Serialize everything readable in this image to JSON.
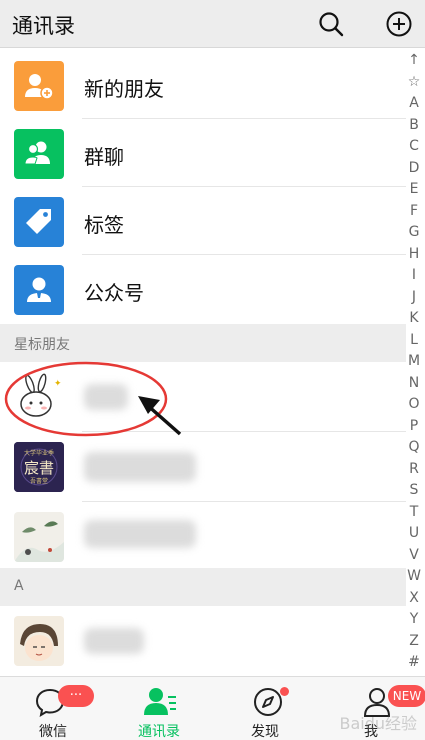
{
  "header": {
    "title": "通讯录",
    "search_icon": "search-icon",
    "add_icon": "plus-circle-icon"
  },
  "functions": [
    {
      "label": "新的朋友",
      "icon": "add-friend-icon",
      "color": "#fa9d3b"
    },
    {
      "label": "群聊",
      "icon": "group-chat-icon",
      "color": "#07c160"
    },
    {
      "label": "标签",
      "icon": "tag-icon",
      "color": "#2782d7"
    },
    {
      "label": "公众号",
      "icon": "official-account-icon",
      "color": "#2782d7"
    }
  ],
  "sections": {
    "starred": "星标朋友",
    "a": "A"
  },
  "index_bar": [
    "↑",
    "☆",
    "A",
    "B",
    "C",
    "D",
    "E",
    "F",
    "G",
    "H",
    "I",
    "J",
    "K",
    "L",
    "M",
    "N",
    "O",
    "P",
    "Q",
    "R",
    "S",
    "T",
    "U",
    "V",
    "W",
    "X",
    "Y",
    "Z",
    "#"
  ],
  "avatar_text": {
    "top": "大学毕业季",
    "main": "宸書",
    "sub": "吾書堂"
  },
  "nav": {
    "items": [
      {
        "label": "微信",
        "icon": "chat-bubble-icon"
      },
      {
        "label": "通讯录",
        "icon": "contacts-icon"
      },
      {
        "label": "发现",
        "icon": "compass-icon"
      },
      {
        "label": "我",
        "icon": "person-icon"
      }
    ],
    "chat_badge": "···",
    "me_badge": "NEW"
  },
  "watermark": "Baidu经验",
  "colors": {
    "accent": "#07c160",
    "badge": "#fa5151",
    "annotation": "#e53935"
  }
}
